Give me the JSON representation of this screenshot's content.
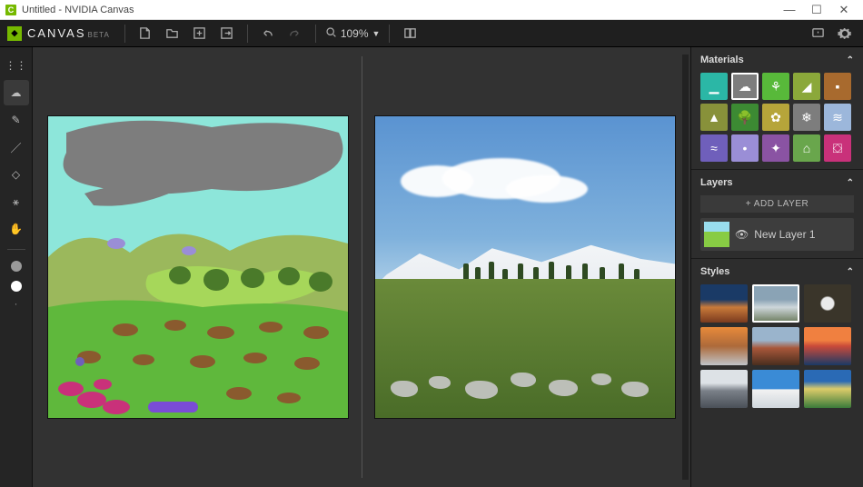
{
  "window": {
    "title": "Untitled - NVIDIA Canvas",
    "minimize": "—",
    "maximize": "☐",
    "close": "✕"
  },
  "app": {
    "brand": "CANVAS",
    "badge": "BETA",
    "zoom_value": "109%"
  },
  "tools": [
    {
      "name": "apps-icon",
      "glyph": "⋮⋮"
    },
    {
      "name": "cloud-icon",
      "glyph": "☁",
      "active": true
    },
    {
      "name": "brush-icon",
      "glyph": "✎"
    },
    {
      "name": "pencil-icon",
      "glyph": "／"
    },
    {
      "name": "eraser-icon",
      "glyph": "◇"
    },
    {
      "name": "eyedropper-icon",
      "glyph": "⚹"
    },
    {
      "name": "hand-icon",
      "glyph": "✋"
    }
  ],
  "swatches": [
    "#9a9a9a",
    "#ffffff"
  ],
  "materials": {
    "title": "Materials",
    "items": [
      {
        "name": "horizon",
        "bg": "#2bb7a6",
        "glyph": "▁"
      },
      {
        "name": "cloud",
        "bg": "#7d7d7d",
        "glyph": "☁",
        "selected": true
      },
      {
        "name": "grass",
        "bg": "#58b93a",
        "glyph": "⚘"
      },
      {
        "name": "hill",
        "bg": "#8ba83a",
        "glyph": "◢"
      },
      {
        "name": "dirt",
        "bg": "#a86a2e",
        "glyph": "▪"
      },
      {
        "name": "mountain",
        "bg": "#88913a",
        "glyph": "▲"
      },
      {
        "name": "tree",
        "bg": "#3c8a33",
        "glyph": "🌳"
      },
      {
        "name": "bush",
        "bg": "#b6a53a",
        "glyph": "✿"
      },
      {
        "name": "snow",
        "bg": "#7d7d7d",
        "glyph": "❄"
      },
      {
        "name": "water",
        "bg": "#9cb7db",
        "glyph": "≋"
      },
      {
        "name": "sea",
        "bg": "#6f5fbb",
        "glyph": "≈"
      },
      {
        "name": "fog",
        "bg": "#9a8ed6",
        "glyph": "•"
      },
      {
        "name": "sparkle",
        "bg": "#8a53a3",
        "glyph": "✦"
      },
      {
        "name": "building",
        "bg": "#69a64c",
        "glyph": "⌂"
      },
      {
        "name": "rock",
        "bg": "#c9317a",
        "glyph": "⛋"
      }
    ]
  },
  "layers": {
    "title": "Layers",
    "add_label": "+ ADD LAYER",
    "items": [
      {
        "name": "New Layer 1"
      }
    ]
  },
  "styles": {
    "title": "Styles",
    "items": [
      {
        "name": "desert-sunset",
        "bg": "linear-gradient(#1a3a66 40%,#c97a3a 60%,#7a3a1e)"
      },
      {
        "name": "cloudy-day",
        "bg": "linear-gradient(#8aa3b5 40%,#cdd6da 60%,#6a7a5a)",
        "selected": true
      },
      {
        "name": "cave",
        "bg": "radial-gradient(circle at 50% 50%,#eaeaea 20%,#3a352a 25%)"
      },
      {
        "name": "fog-sunset",
        "bg": "linear-gradient(#e88a3a,#ad6a3a 50%,#bfc3c8)"
      },
      {
        "name": "red-peak",
        "bg": "linear-gradient(#9ab4cc 35%,#a8573a 55%,#4a2e1e)"
      },
      {
        "name": "ocean-sunset",
        "bg": "linear-gradient(#f08040 35%,#c94a3a 50%,#1a3a66)"
      },
      {
        "name": "grey-mtn",
        "bg": "linear-gradient(#dde2e6 35%,#7a8088 55%,#4a5058)"
      },
      {
        "name": "blue-sky",
        "bg": "linear-gradient(#3a8bd6 50%,#f2f2f2 52%,#cfd6dc)"
      },
      {
        "name": "alpine",
        "bg": "linear-gradient(#2a6ab5 30%,#dccc6a 50%,#3a7a3a)"
      }
    ]
  }
}
